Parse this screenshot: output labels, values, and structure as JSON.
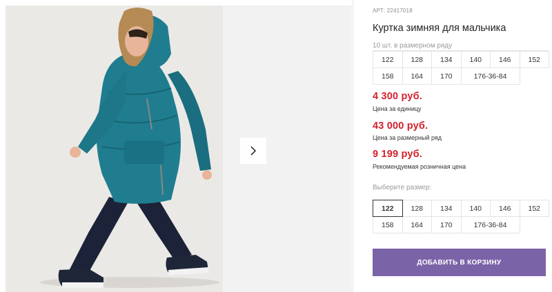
{
  "product": {
    "sku": "АРТ: 22417018",
    "title": "Куртка зимняя для мальчика",
    "pack_note": "10 шт. в размерном ряду"
  },
  "pack_sizes": [
    "122",
    "128",
    "134",
    "140",
    "146",
    "152",
    "158",
    "164",
    "170",
    "176-36-84"
  ],
  "prices": {
    "unit": {
      "value": "4 300 руб.",
      "label": "Цена за единицу"
    },
    "pack": {
      "value": "43 000 руб.",
      "label": "Цена за размерный ряд"
    },
    "retail": {
      "value": "9 199 руб.",
      "label": "Рекомендуемая розничная цена"
    }
  },
  "size_select": {
    "label": "Выберите размер:",
    "options": [
      "122",
      "128",
      "134",
      "140",
      "146",
      "152",
      "158",
      "164",
      "170",
      "176-36-84"
    ],
    "selected": "122"
  },
  "cart_button": "ДОБАВИТЬ В КОРЗИНУ",
  "icons": {
    "next": "chevron-right-icon"
  },
  "colors": {
    "price": "#d4202c",
    "button": "#7b63a8",
    "jacket": "#1f7d8f",
    "pants": "#1c2238"
  }
}
